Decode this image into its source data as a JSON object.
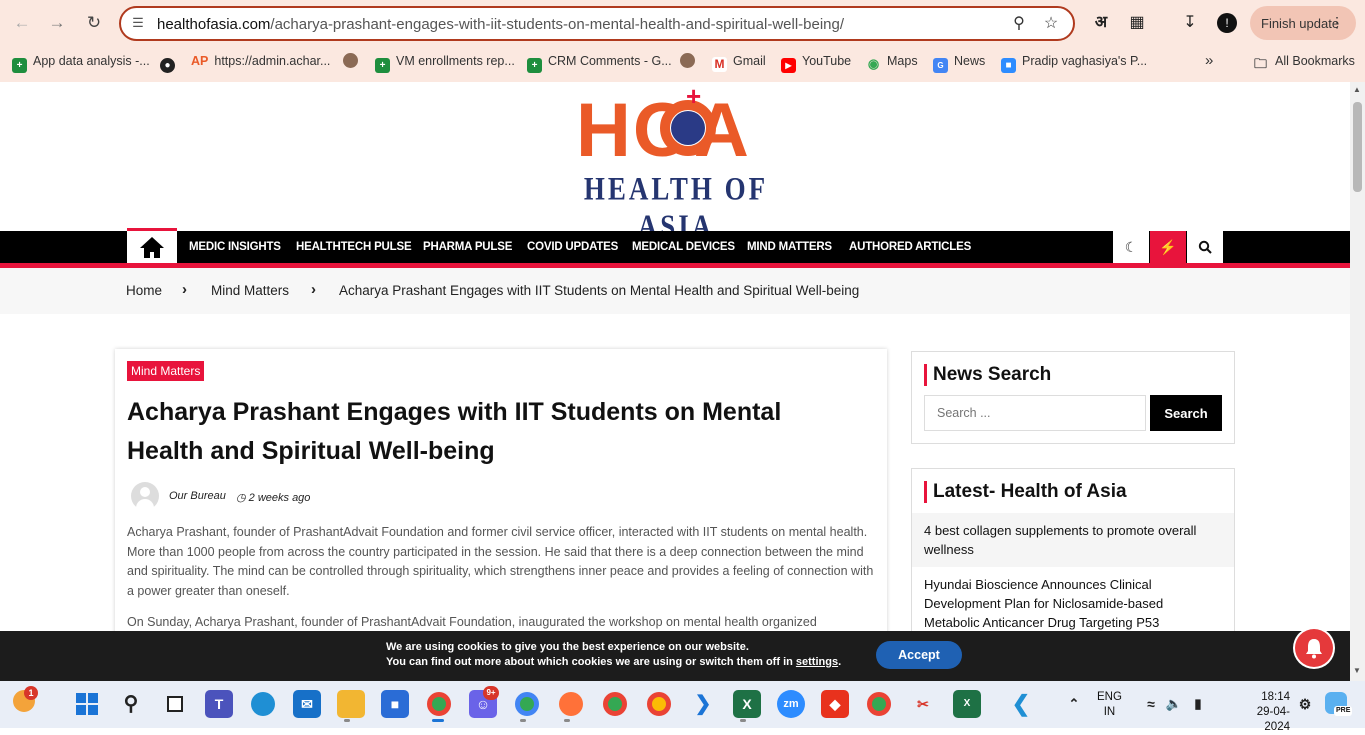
{
  "browser": {
    "url_host": "healthofasia.com",
    "url_path": "/acharya-prashant-engages-with-iit-students-on-mental-health-and-spiritual-well-being/",
    "translate_glyph": "अ",
    "finish_update_label": "Finish update",
    "bookmarks": [
      {
        "label": "App data analysis -...",
        "icon": "sheets-icon",
        "color": "#1e8e3e"
      },
      {
        "label": "",
        "icon": "globe-icon",
        "color": "#222222"
      },
      {
        "label": "https://admin.achar...",
        "prefix": "AP",
        "icon": "ap-icon",
        "color": "#ea5a28"
      },
      {
        "label": "VM enrollments rep...",
        "icon": "sheets-icon",
        "color": "#1e8e3e"
      },
      {
        "label": "CRM Comments - G...",
        "icon": "sheets-icon",
        "color": "#1e8e3e"
      },
      {
        "label": "Gmail",
        "icon": "gmail-icon",
        "color": "#d93025"
      },
      {
        "label": "YouTube",
        "icon": "youtube-icon",
        "color": "#ff0000"
      },
      {
        "label": "Maps",
        "icon": "maps-icon",
        "color": "#34a853"
      },
      {
        "label": "News",
        "icon": "news-icon",
        "color": "#4285f4"
      },
      {
        "label": "Pradip vaghasiya's P...",
        "icon": "zoom-icon",
        "color": "#2d8cff"
      }
    ],
    "more_bookmarks": "»",
    "all_bookmarks_label": "All Bookmarks"
  },
  "site": {
    "logo_text": "HOA",
    "logo_tagline": "HEALTH OF ASIA",
    "brand_color": "#e8143c",
    "logo_color": "#ea5a28",
    "tagline_color": "#253570",
    "nav": [
      "MEDIC INSIGHTS",
      "HEALTHTECH PULSE",
      "PHARMA PULSE",
      "COVID UPDATES",
      "MEDICAL DEVICES",
      "MIND MATTERS",
      "AUTHORED ARTICLES"
    ],
    "breadcrumb": {
      "home": "Home",
      "section": "Mind Matters",
      "current": "Acharya Prashant Engages with IIT Students on Mental Health and Spiritual Well-being"
    }
  },
  "article": {
    "category": "Mind Matters",
    "title": "Acharya Prashant Engages with IIT Students on Mental Health and Spiritual Well-being",
    "author": "Our Bureau",
    "date": "2 weeks ago",
    "p1": "Acharya Prashant, founder of PrashantAdvait Foundation and former civil service officer, interacted with IIT students on mental health. More than 1000 people from across the country participated in the session. He said that there is a deep connection between the mind and spirituality. The mind can be controlled through spirituality, which strengthens inner peace and provides a feeling of connection with a power greater than oneself.",
    "p2": "On Sunday, Acharya Prashant, founder of PrashantAdvait Foundation, inaugurated the workshop on mental health organized"
  },
  "sidebar": {
    "search": {
      "title": "News Search",
      "placeholder": "Search ...",
      "button": "Search"
    },
    "latest": {
      "title": "Latest- Health of Asia",
      "items": [
        "4 best collagen supplements to promote overall wellness",
        "Hyundai Bioscience Announces Clinical Development Plan for Niclosamide-based Metabolic Anticancer Drug Targeting P53"
      ]
    }
  },
  "cookie": {
    "line1": "We are using cookies to give you the best experience on our website.",
    "line2_prefix": "You can find out more about which cookies we are using or switch them off in ",
    "line2_link": "settings",
    "line2_suffix": ".",
    "accept": "Accept"
  },
  "taskbar": {
    "weather_badge": "1",
    "discord_badge": "9+",
    "lang": "ENG",
    "region": "IN",
    "time": "18:14",
    "date": "29-04-2024",
    "copilot_tag": "PRE"
  }
}
